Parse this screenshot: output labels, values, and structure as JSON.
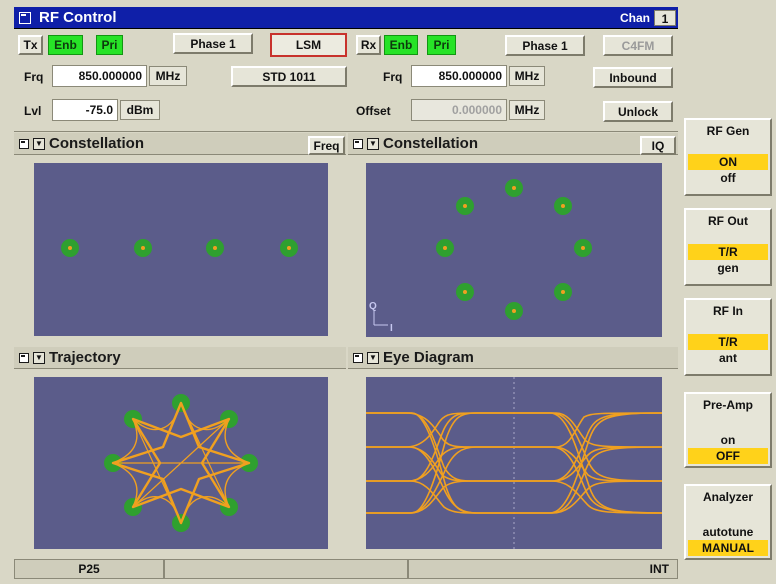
{
  "window": {
    "title": "RF Control",
    "chan_label": "Chan",
    "chan_value": "1"
  },
  "tx": {
    "label": "Tx",
    "enb": "Enb",
    "pri": "Pri",
    "phase": "Phase 1",
    "mode": "LSM",
    "std": "STD 1011",
    "frq_label": "Frq",
    "frq_value": "850.000000",
    "frq_unit": "MHz",
    "lvl_label": "Lvl",
    "lvl_value": "-75.0",
    "lvl_unit": "dBm"
  },
  "rx": {
    "label": "Rx",
    "enb": "Enb",
    "pri": "Pri",
    "phase": "Phase 1",
    "mode": "C4FM",
    "frq_label": "Frq",
    "frq_value": "850.000000",
    "frq_unit": "MHz",
    "inbound": "Inbound",
    "offset_label": "Offset",
    "offset_value": "0.000000",
    "offset_unit": "MHz",
    "unlock": "Unlock"
  },
  "panels": {
    "tl": {
      "title": "Constellation",
      "button": "Freq"
    },
    "tr": {
      "title": "Constellation",
      "button": "IQ",
      "axis_q": "Q",
      "axis_i": "I"
    },
    "bl": {
      "title": "Trajectory"
    },
    "br": {
      "title": "Eye Diagram"
    }
  },
  "side": [
    {
      "title": "RF Gen",
      "opt1": "ON",
      "opt2": "off",
      "selected": 1
    },
    {
      "title": "RF Out",
      "opt1": "T/R",
      "opt2": "gen",
      "selected": 1
    },
    {
      "title": "RF In",
      "opt1": "T/R",
      "opt2": "ant",
      "selected": 1
    },
    {
      "title": "Pre-Amp",
      "opt1": "on",
      "opt2": "OFF",
      "selected": 2
    },
    {
      "title": "Analyzer",
      "opt1": "autotune",
      "opt2": "MANUAL",
      "selected": 2
    }
  ],
  "status": {
    "left": "P25",
    "mid": "",
    "right": "INT"
  },
  "colors": {
    "plot_bg": "#5b5c8a",
    "point": "#2fa02f",
    "trace": "#f0a020",
    "selected": "#ffd21a",
    "title_bar": "#0f1fa8"
  }
}
